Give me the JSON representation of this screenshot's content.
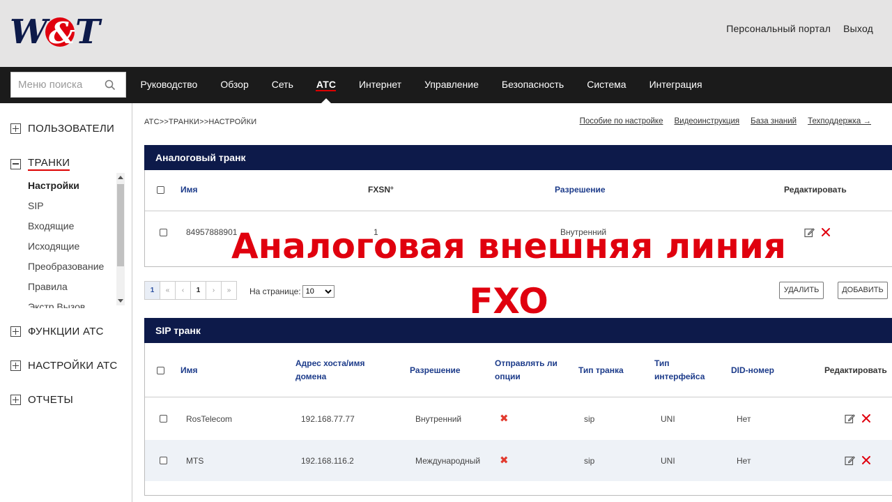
{
  "header": {
    "logo_text": "W&T",
    "links": [
      "Персональный портал",
      "Выход"
    ]
  },
  "nav": {
    "search_placeholder": "Меню поиска",
    "items": [
      {
        "label": "Руководство"
      },
      {
        "label": "Обзор"
      },
      {
        "label": "Сеть"
      },
      {
        "label": "АТС",
        "active": true
      },
      {
        "label": "Интернет"
      },
      {
        "label": "Управление"
      },
      {
        "label": "Безопасность"
      },
      {
        "label": "Система"
      },
      {
        "label": "Интеграция"
      }
    ]
  },
  "sidebar": {
    "groups": [
      {
        "label": "ПОЛЬЗОВАТЕЛИ",
        "expanded": false
      },
      {
        "label": "ТРАНКИ",
        "expanded": true
      },
      {
        "label": "ФУНКЦИИ АТС",
        "expanded": false
      },
      {
        "label": "НАСТРОЙКИ АТС",
        "expanded": false
      },
      {
        "label": "ОТЧЕТЫ",
        "expanded": false
      }
    ],
    "trunk_items": [
      "Настройки",
      "SIP",
      "Входящие",
      "Исходящие",
      "Преобразование",
      "Правила",
      "Экстр.Вызов"
    ],
    "active_item": "Настройки"
  },
  "breadcrumb": "АТС>>ТРАНКИ>>НАСТРОЙКИ",
  "help_links": [
    "Пособие по настройке",
    "Видеоинструкция",
    "База знаний",
    "Техподдержка →"
  ],
  "analog": {
    "title": "Аналоговый транк",
    "columns": [
      "Имя",
      "FXSN°",
      "Разрешение",
      "Редактировать"
    ],
    "rows": [
      {
        "name": "84957888901",
        "fxsn": "1",
        "permission": "Внутренний"
      }
    ]
  },
  "pagination": {
    "buttons": [
      "1",
      "«",
      "‹",
      "1",
      "›",
      "»"
    ],
    "per_page_label": "На странице:",
    "per_page_value": "10",
    "delete_label": "УДАЛИТЬ",
    "add_label": "ДОБАВИТЬ"
  },
  "sip": {
    "title": "SIP транк",
    "columns": {
      "name": "Имя",
      "host": [
        "Адрес хоста/имя",
        "домена"
      ],
      "permission": "Разрешение",
      "send_options": [
        "Отправлять ли",
        "опции"
      ],
      "trunk_type": "Тип транка",
      "interface_type": [
        "Тип",
        "интерфейса"
      ],
      "did": "DID-номер",
      "edit": "Редактировать"
    },
    "rows": [
      {
        "name": "RosTelecom",
        "host": "192.168.77.77",
        "permission": "Внутренний",
        "send_options": "✖",
        "trunk_type": "sip",
        "interface": "UNI",
        "did": "Нет"
      },
      {
        "name": "MTS",
        "host": "192.168.116.2",
        "permission": "Международный",
        "send_options": "✖",
        "trunk_type": "sip",
        "interface": "UNI",
        "did": "Нет"
      }
    ]
  },
  "overlay": {
    "line1": "Аналоговая внешняя линия",
    "line2": "FXO"
  },
  "colors": {
    "accent_red": "#e0000e",
    "panel_navy": "#0d1a4a",
    "nav_dark": "#1b1b1b",
    "header_gray": "#e5e4e4"
  }
}
